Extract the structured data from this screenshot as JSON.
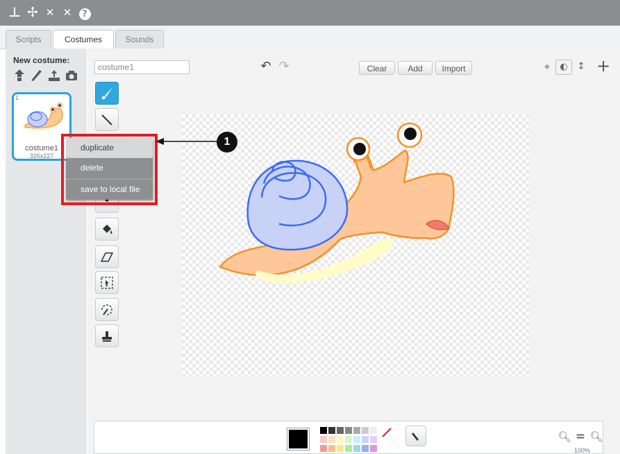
{
  "toolbar": {
    "icons": [
      "stamp-icon",
      "cut-icon",
      "grow-icon",
      "shrink-icon",
      "help-icon"
    ],
    "glyphs": [
      "⊥",
      "✢",
      "✕",
      "✕",
      "?"
    ]
  },
  "tabs": [
    {
      "label": "Scripts",
      "active": false
    },
    {
      "label": "Costumes",
      "active": true
    },
    {
      "label": "Sounds",
      "active": false
    }
  ],
  "new_costume": {
    "label": "New costume:",
    "icons": [
      "sprite-library-icon",
      "paint-icon",
      "upload-icon",
      "camera-icon"
    ]
  },
  "costume": {
    "number": "1",
    "name": "costume1",
    "size": "326x227"
  },
  "editor": {
    "name_value": "costume1",
    "clear_label": "Clear",
    "add_label": "Add",
    "import_label": "Import"
  },
  "context_menu": {
    "items": [
      "duplicate",
      "delete",
      "save to local file"
    ]
  },
  "callout": {
    "number": "1"
  },
  "zoom": {
    "label": "100%"
  },
  "colors": {
    "accent": "#29a3dd",
    "highlight": "#e31b23",
    "menu_bg": "#8e8f91"
  }
}
